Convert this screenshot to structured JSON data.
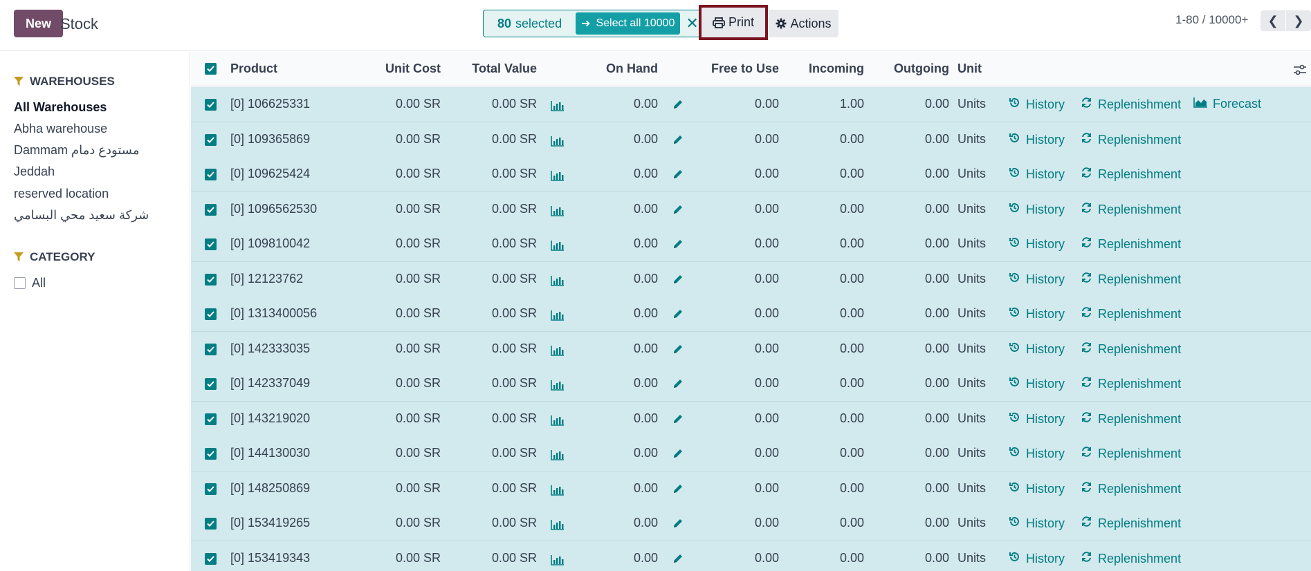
{
  "header": {
    "new_label": "New",
    "title": "Stock",
    "selection": {
      "count": "80",
      "count_suffix": "selected",
      "select_all_label": "Select all 10000"
    },
    "print_label": "Print",
    "actions_label": "Actions",
    "pager": "1-80 / 10000+"
  },
  "sidebar": {
    "warehouses_title": "WAREHOUSES",
    "warehouses": [
      {
        "label": "All Warehouses",
        "active": true
      },
      {
        "label": "Abha warehouse",
        "active": false
      },
      {
        "label": "Dammam مستودع دمام",
        "active": false
      },
      {
        "label": "Jeddah",
        "active": false
      },
      {
        "label": "reserved location",
        "active": false
      },
      {
        "label": "شركة سعيد محي البسامي",
        "active": false
      }
    ],
    "category_title": "CATEGORY",
    "category_items": [
      {
        "label": "All",
        "checked": false
      }
    ]
  },
  "table": {
    "columns": {
      "product": "Product",
      "unit_cost": "Unit Cost",
      "total_value": "Total Value",
      "on_hand": "On Hand",
      "free_to_use": "Free to Use",
      "incoming": "Incoming",
      "outgoing": "Outgoing",
      "unit": "Unit"
    },
    "action_labels": {
      "history": "History",
      "replenishment": "Replenishment",
      "forecast": "Forecast"
    },
    "rows": [
      {
        "product": "[0] 106625331",
        "unit_cost": "0.00 SR",
        "total_value": "0.00 SR",
        "on_hand": "0.00",
        "free_to_use": "0.00",
        "incoming": "1.00",
        "outgoing": "0.00",
        "unit": "Units",
        "forecast": true
      },
      {
        "product": "[0] 109365869",
        "unit_cost": "0.00 SR",
        "total_value": "0.00 SR",
        "on_hand": "0.00",
        "free_to_use": "0.00",
        "incoming": "0.00",
        "outgoing": "0.00",
        "unit": "Units",
        "forecast": false
      },
      {
        "product": "[0] 109625424",
        "unit_cost": "0.00 SR",
        "total_value": "0.00 SR",
        "on_hand": "0.00",
        "free_to_use": "0.00",
        "incoming": "0.00",
        "outgoing": "0.00",
        "unit": "Units",
        "forecast": false
      },
      {
        "product": "[0] 1096562530",
        "unit_cost": "0.00 SR",
        "total_value": "0.00 SR",
        "on_hand": "0.00",
        "free_to_use": "0.00",
        "incoming": "0.00",
        "outgoing": "0.00",
        "unit": "Units",
        "forecast": false
      },
      {
        "product": "[0] 109810042",
        "unit_cost": "0.00 SR",
        "total_value": "0.00 SR",
        "on_hand": "0.00",
        "free_to_use": "0.00",
        "incoming": "0.00",
        "outgoing": "0.00",
        "unit": "Units",
        "forecast": false
      },
      {
        "product": "[0] 12123762",
        "unit_cost": "0.00 SR",
        "total_value": "0.00 SR",
        "on_hand": "0.00",
        "free_to_use": "0.00",
        "incoming": "0.00",
        "outgoing": "0.00",
        "unit": "Units",
        "forecast": false
      },
      {
        "product": "[0] 1313400056",
        "unit_cost": "0.00 SR",
        "total_value": "0.00 SR",
        "on_hand": "0.00",
        "free_to_use": "0.00",
        "incoming": "0.00",
        "outgoing": "0.00",
        "unit": "Units",
        "forecast": false
      },
      {
        "product": "[0] 142333035",
        "unit_cost": "0.00 SR",
        "total_value": "0.00 SR",
        "on_hand": "0.00",
        "free_to_use": "0.00",
        "incoming": "0.00",
        "outgoing": "0.00",
        "unit": "Units",
        "forecast": false
      },
      {
        "product": "[0] 142337049",
        "unit_cost": "0.00 SR",
        "total_value": "0.00 SR",
        "on_hand": "0.00",
        "free_to_use": "0.00",
        "incoming": "0.00",
        "outgoing": "0.00",
        "unit": "Units",
        "forecast": false
      },
      {
        "product": "[0] 143219020",
        "unit_cost": "0.00 SR",
        "total_value": "0.00 SR",
        "on_hand": "0.00",
        "free_to_use": "0.00",
        "incoming": "0.00",
        "outgoing": "0.00",
        "unit": "Units",
        "forecast": false
      },
      {
        "product": "[0] 144130030",
        "unit_cost": "0.00 SR",
        "total_value": "0.00 SR",
        "on_hand": "0.00",
        "free_to_use": "0.00",
        "incoming": "0.00",
        "outgoing": "0.00",
        "unit": "Units",
        "forecast": false
      },
      {
        "product": "[0] 148250869",
        "unit_cost": "0.00 SR",
        "total_value": "0.00 SR",
        "on_hand": "0.00",
        "free_to_use": "0.00",
        "incoming": "0.00",
        "outgoing": "0.00",
        "unit": "Units",
        "forecast": false
      },
      {
        "product": "[0] 153419265",
        "unit_cost": "0.00 SR",
        "total_value": "0.00 SR",
        "on_hand": "0.00",
        "free_to_use": "0.00",
        "incoming": "0.00",
        "outgoing": "0.00",
        "unit": "Units",
        "forecast": false
      },
      {
        "product": "[0] 153419343",
        "unit_cost": "0.00 SR",
        "total_value": "0.00 SR",
        "on_hand": "0.00",
        "free_to_use": "0.00",
        "incoming": "0.00",
        "outgoing": "0.00",
        "unit": "Units",
        "forecast": false
      }
    ]
  },
  "colors": {
    "brand": "#714b67",
    "teal": "#017e84",
    "row_selected": "#d2e9ed",
    "print_highlight": "#7b1420"
  },
  "icons": [
    "arrow-right-icon",
    "close-icon",
    "printer-icon",
    "gear-icon",
    "chevron-left-icon",
    "chevron-right-icon",
    "filter-icon",
    "checkbox-icon",
    "bar-chart-icon",
    "pencil-icon",
    "history-icon",
    "refresh-icon",
    "area-chart-icon",
    "column-settings-icon"
  ]
}
